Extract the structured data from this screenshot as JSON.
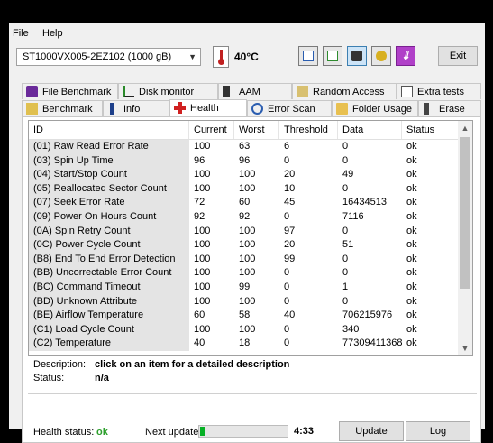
{
  "menu": {
    "file": "File",
    "help": "Help"
  },
  "toolbar": {
    "drive": "ST1000VX005-2EZ102 (1000 gB)",
    "temperature": "40°C",
    "exit_label": "Exit"
  },
  "tabs_top": [
    "File Benchmark",
    "Disk monitor",
    "AAM",
    "Random Access",
    "Extra tests"
  ],
  "tabs_bottom": [
    "Benchmark",
    "Info",
    "Health",
    "Error Scan",
    "Folder Usage",
    "Erase"
  ],
  "active_tab": "Health",
  "table": {
    "columns": [
      "ID",
      "Current",
      "Worst",
      "Threshold",
      "Data",
      "Status"
    ],
    "rows": [
      [
        "(01) Raw Read Error Rate",
        "100",
        "63",
        "6",
        "0",
        "ok"
      ],
      [
        "(03) Spin Up Time",
        "96",
        "96",
        "0",
        "0",
        "ok"
      ],
      [
        "(04) Start/Stop Count",
        "100",
        "100",
        "20",
        "49",
        "ok"
      ],
      [
        "(05) Reallocated Sector Count",
        "100",
        "100",
        "10",
        "0",
        "ok"
      ],
      [
        "(07) Seek Error Rate",
        "72",
        "60",
        "45",
        "16434513",
        "ok"
      ],
      [
        "(09) Power On Hours Count",
        "92",
        "92",
        "0",
        "7116",
        "ok"
      ],
      [
        "(0A) Spin Retry Count",
        "100",
        "100",
        "97",
        "0",
        "ok"
      ],
      [
        "(0C) Power Cycle Count",
        "100",
        "100",
        "20",
        "51",
        "ok"
      ],
      [
        "(B8) End To End Error Detection",
        "100",
        "100",
        "99",
        "0",
        "ok"
      ],
      [
        "(BB) Uncorrectable Error Count",
        "100",
        "100",
        "0",
        "0",
        "ok"
      ],
      [
        "(BC) Command Timeout",
        "100",
        "99",
        "0",
        "1",
        "ok"
      ],
      [
        "(BD) Unknown Attribute",
        "100",
        "100",
        "0",
        "0",
        "ok"
      ],
      [
        "(BE) Airflow Temperature",
        "60",
        "58",
        "40",
        "706215976",
        "ok"
      ],
      [
        "(C1) Load Cycle Count",
        "100",
        "100",
        "0",
        "340",
        "ok"
      ],
      [
        "(C2) Temperature",
        "40",
        "18",
        "0",
        "77309411368",
        "ok"
      ]
    ]
  },
  "description": {
    "label": "Description:",
    "value": "click on an item for a detailed description",
    "status_label": "Status:",
    "status_value": "n/a"
  },
  "footer": {
    "health_label": "Health status:",
    "health_value": "ok",
    "next_update_label": "Next update:",
    "progress_fraction": 0.05,
    "countdown": "4:33",
    "update_label": "Update",
    "log_label": "Log"
  },
  "colors": {
    "ok_green": "#2ea02e",
    "progress": "#06b025"
  }
}
